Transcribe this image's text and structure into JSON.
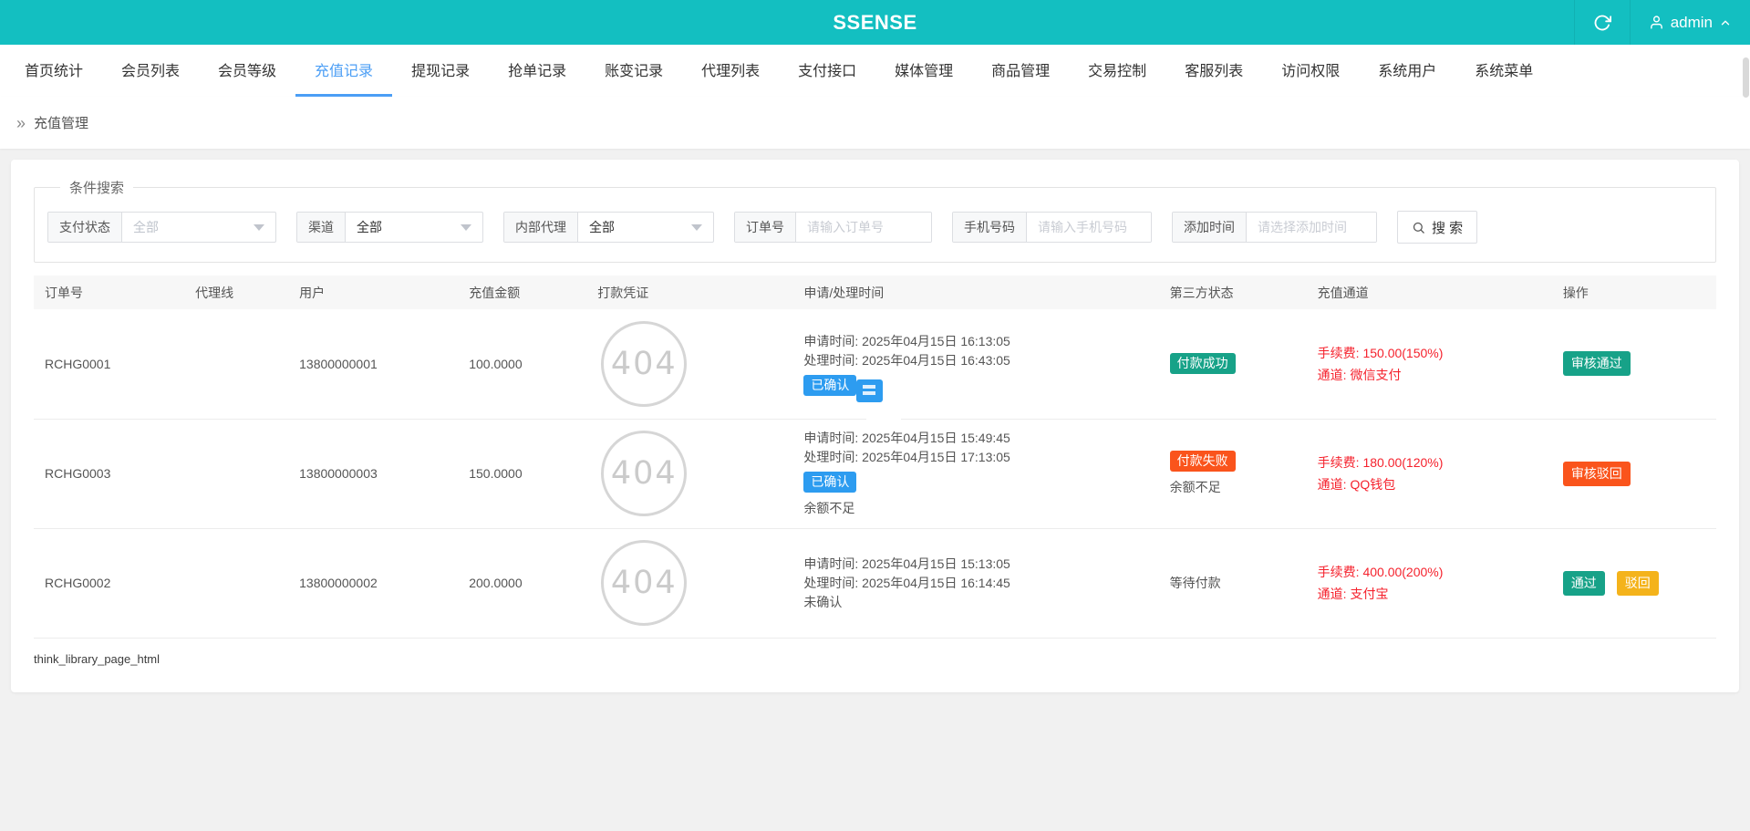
{
  "header": {
    "title": "SSENSE",
    "username": "admin"
  },
  "nav": {
    "tabs": [
      {
        "label": "首页统计"
      },
      {
        "label": "会员列表"
      },
      {
        "label": "会员等级"
      },
      {
        "label": "充值记录",
        "active": true
      },
      {
        "label": "提现记录"
      },
      {
        "label": "抢单记录"
      },
      {
        "label": "账变记录"
      },
      {
        "label": "代理列表"
      },
      {
        "label": "支付接口"
      },
      {
        "label": "媒体管理"
      },
      {
        "label": "商品管理"
      },
      {
        "label": "交易控制"
      },
      {
        "label": "客服列表"
      },
      {
        "label": "访问权限"
      },
      {
        "label": "系统用户"
      },
      {
        "label": "系统菜单"
      }
    ]
  },
  "breadcrumb": {
    "section": "充值管理"
  },
  "search": {
    "legend": "条件搜索",
    "filters": [
      {
        "label": "支付状态",
        "value": "全部"
      },
      {
        "label": "渠道",
        "value": "全部"
      },
      {
        "label": "内部代理",
        "value": "全部"
      },
      {
        "label": "订单号",
        "placeholder": "请输入订单号"
      },
      {
        "label": "手机号码",
        "placeholder": "请输入手机号码"
      },
      {
        "label": "添加时间",
        "placeholder": "请选择添加时间"
      }
    ],
    "search_button": "搜 索"
  },
  "table": {
    "columns": [
      "订单号",
      "代理线",
      "用户",
      "充值金额",
      "打款凭证",
      "申请/处理时间",
      "第三方状态",
      "充值通道",
      "操作"
    ],
    "rows": [
      {
        "order_no": "RCHG0001",
        "agent_line": "",
        "user": "13800000001",
        "amount": "100.0000",
        "proof": "404",
        "apply_time": "申请时间: 2025年04月15日 16:13:05",
        "process_time": "处理时间: 2025年04月15日 16:43:05",
        "confirm_badge": "已确认",
        "third_badge": "付款成功",
        "fee": "手续费: 150.00(150%)",
        "channel": "通道: 微信支付",
        "action_primary": "审核通过"
      },
      {
        "order_no": "RCHG0003",
        "agent_line": "",
        "user": "13800000003",
        "amount": "150.0000",
        "proof": "404",
        "apply_time": "申请时间: 2025年04月15日 15:49:45",
        "process_time": "处理时间: 2025年04月15日 17:13:05",
        "confirm_badge": "已确认",
        "confirm_note": "余额不足",
        "third_badge": "付款失败",
        "third_note": "余额不足",
        "fee": "手续费: 180.00(120%)",
        "channel": "通道: QQ钱包",
        "action_primary": "审核驳回"
      },
      {
        "order_no": "RCHG0002",
        "agent_line": "",
        "user": "13800000002",
        "amount": "200.0000",
        "proof": "404",
        "apply_time": "申请时间: 2025年04月15日 15:13:05",
        "process_time": "处理时间: 2025年04月15日 16:14:45",
        "confirm_text": "未确认",
        "third_text": "等待付款",
        "fee": "手续费: 400.00(200%)",
        "channel": "通道: 支付宝",
        "action_primary": "通过",
        "action_secondary": "驳回"
      }
    ]
  },
  "footer": {
    "text": "think_library_page_html"
  },
  "colors": {
    "header_bg": "#13bfc1",
    "active_tab": "#4b9ef5",
    "badge_confirmed_blue": "#2d9cf0",
    "status_success_teal": "#17a288",
    "status_fail_orange": "#fa541c",
    "button_revoke_yellow": "#f4b31b",
    "amount_red": "#f5222d"
  }
}
